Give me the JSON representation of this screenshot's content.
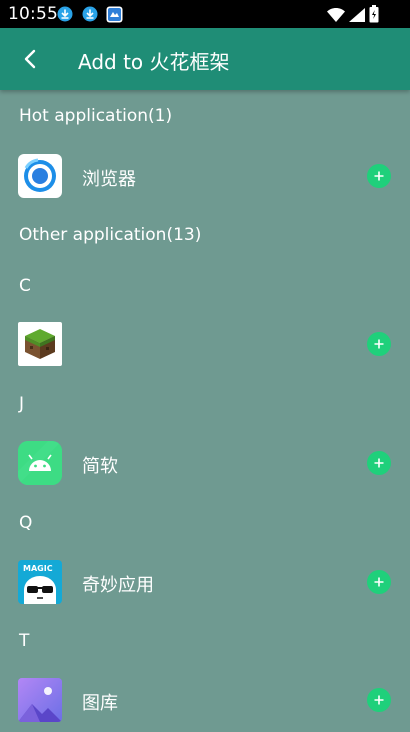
{
  "status_bar": {
    "time": "10:55"
  },
  "toolbar": {
    "title": "Add to 火花框架",
    "back_icon": "arrow-back-icon"
  },
  "sections": {
    "hot": "Hot application(1)",
    "other": "Other application(13)"
  },
  "letters": {
    "c": "C",
    "j": "J",
    "q": "Q",
    "t": "T"
  },
  "apps": {
    "browser": {
      "name": "浏览器"
    },
    "minecraft": {
      "name": ""
    },
    "jianruan": {
      "name": "简软"
    },
    "qimiao": {
      "name": "奇妙应用",
      "icon_text": "MAGIC"
    },
    "gallery": {
      "name": "图库"
    }
  },
  "colors": {
    "background": "#6f9a91",
    "toolbar": "#1f8d76",
    "add_button": "#1fd07b"
  }
}
